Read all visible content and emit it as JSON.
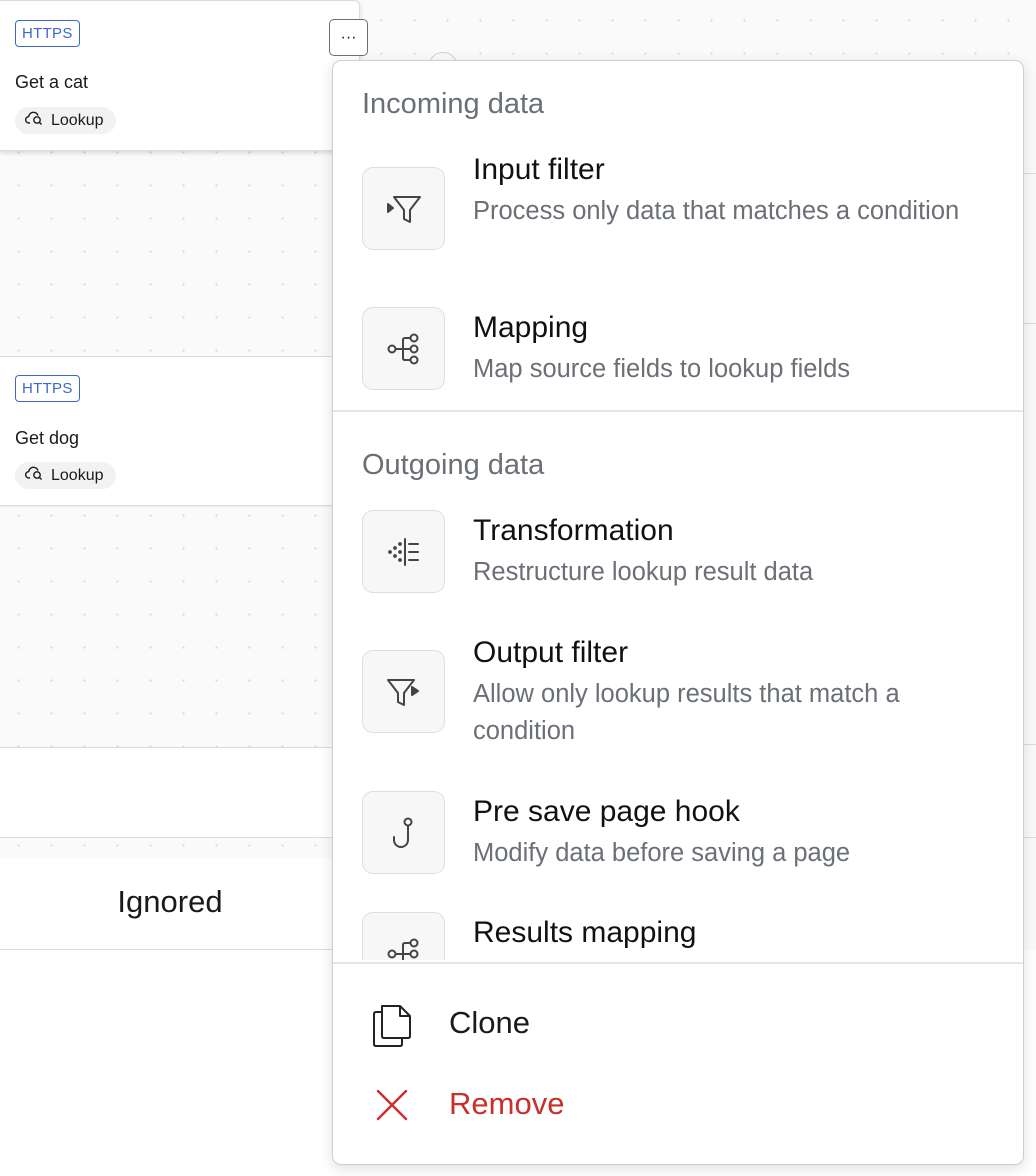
{
  "canvas": {
    "cards": [
      {
        "badge": "HTTPS",
        "title": "Get a cat",
        "chip_label": "Lookup"
      },
      {
        "badge": "HTTPS",
        "title": "Get dog",
        "chip_label": "Lookup"
      }
    ],
    "more_button_label": "···",
    "ignored_label": "Ignored"
  },
  "menu": {
    "sections": {
      "incoming": {
        "heading": "Incoming data",
        "items": [
          {
            "icon": "input-filter-icon",
            "title": "Input filter",
            "description": "Process only data that matches a condition"
          },
          {
            "icon": "mapping-icon",
            "title": "Mapping",
            "description": "Map source fields to lookup fields"
          }
        ]
      },
      "outgoing": {
        "heading": "Outgoing data",
        "items": [
          {
            "icon": "transformation-icon",
            "title": "Transformation",
            "description": "Restructure lookup result data"
          },
          {
            "icon": "output-filter-icon",
            "title": "Output filter",
            "description": "Allow only lookup results that match a condition"
          },
          {
            "icon": "hook-icon",
            "title": "Pre save page hook",
            "description": "Modify data before saving a page"
          },
          {
            "icon": "results-mapping-icon",
            "title": "Results mapping",
            "description": ""
          }
        ]
      }
    },
    "actions": {
      "clone": {
        "icon": "copy-icon",
        "label": "Clone"
      },
      "remove": {
        "icon": "close-icon",
        "label": "Remove"
      }
    }
  },
  "colors": {
    "badge_blue": "#3f68c9",
    "danger_red": "#c9302c",
    "muted_text": "#6b6f76"
  }
}
